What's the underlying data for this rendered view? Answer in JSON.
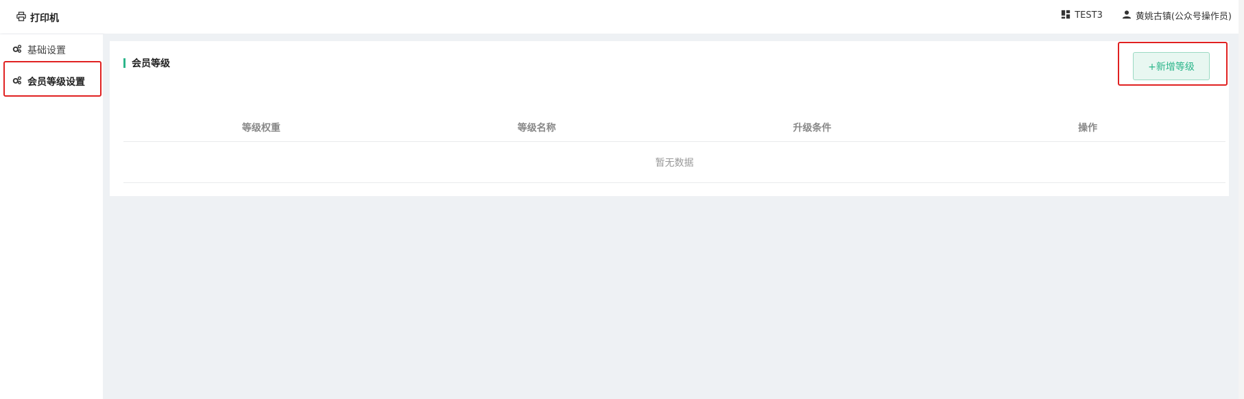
{
  "header": {
    "brand_label": "打印机",
    "store_label": "TEST3",
    "user_label": "黄姚古镇(公众号操作员)"
  },
  "sidebar": {
    "items": [
      {
        "label": "基础设置"
      },
      {
        "label": "会员等级设置"
      }
    ]
  },
  "main": {
    "title": "会员等级",
    "add_button_label": "+新增等级",
    "table": {
      "columns": [
        "等级权重",
        "等级名称",
        "升级条件",
        "操作"
      ],
      "empty_text": "暂无数据"
    }
  },
  "colors": {
    "accent": "#2bb58a",
    "highlight": "#e02020"
  }
}
